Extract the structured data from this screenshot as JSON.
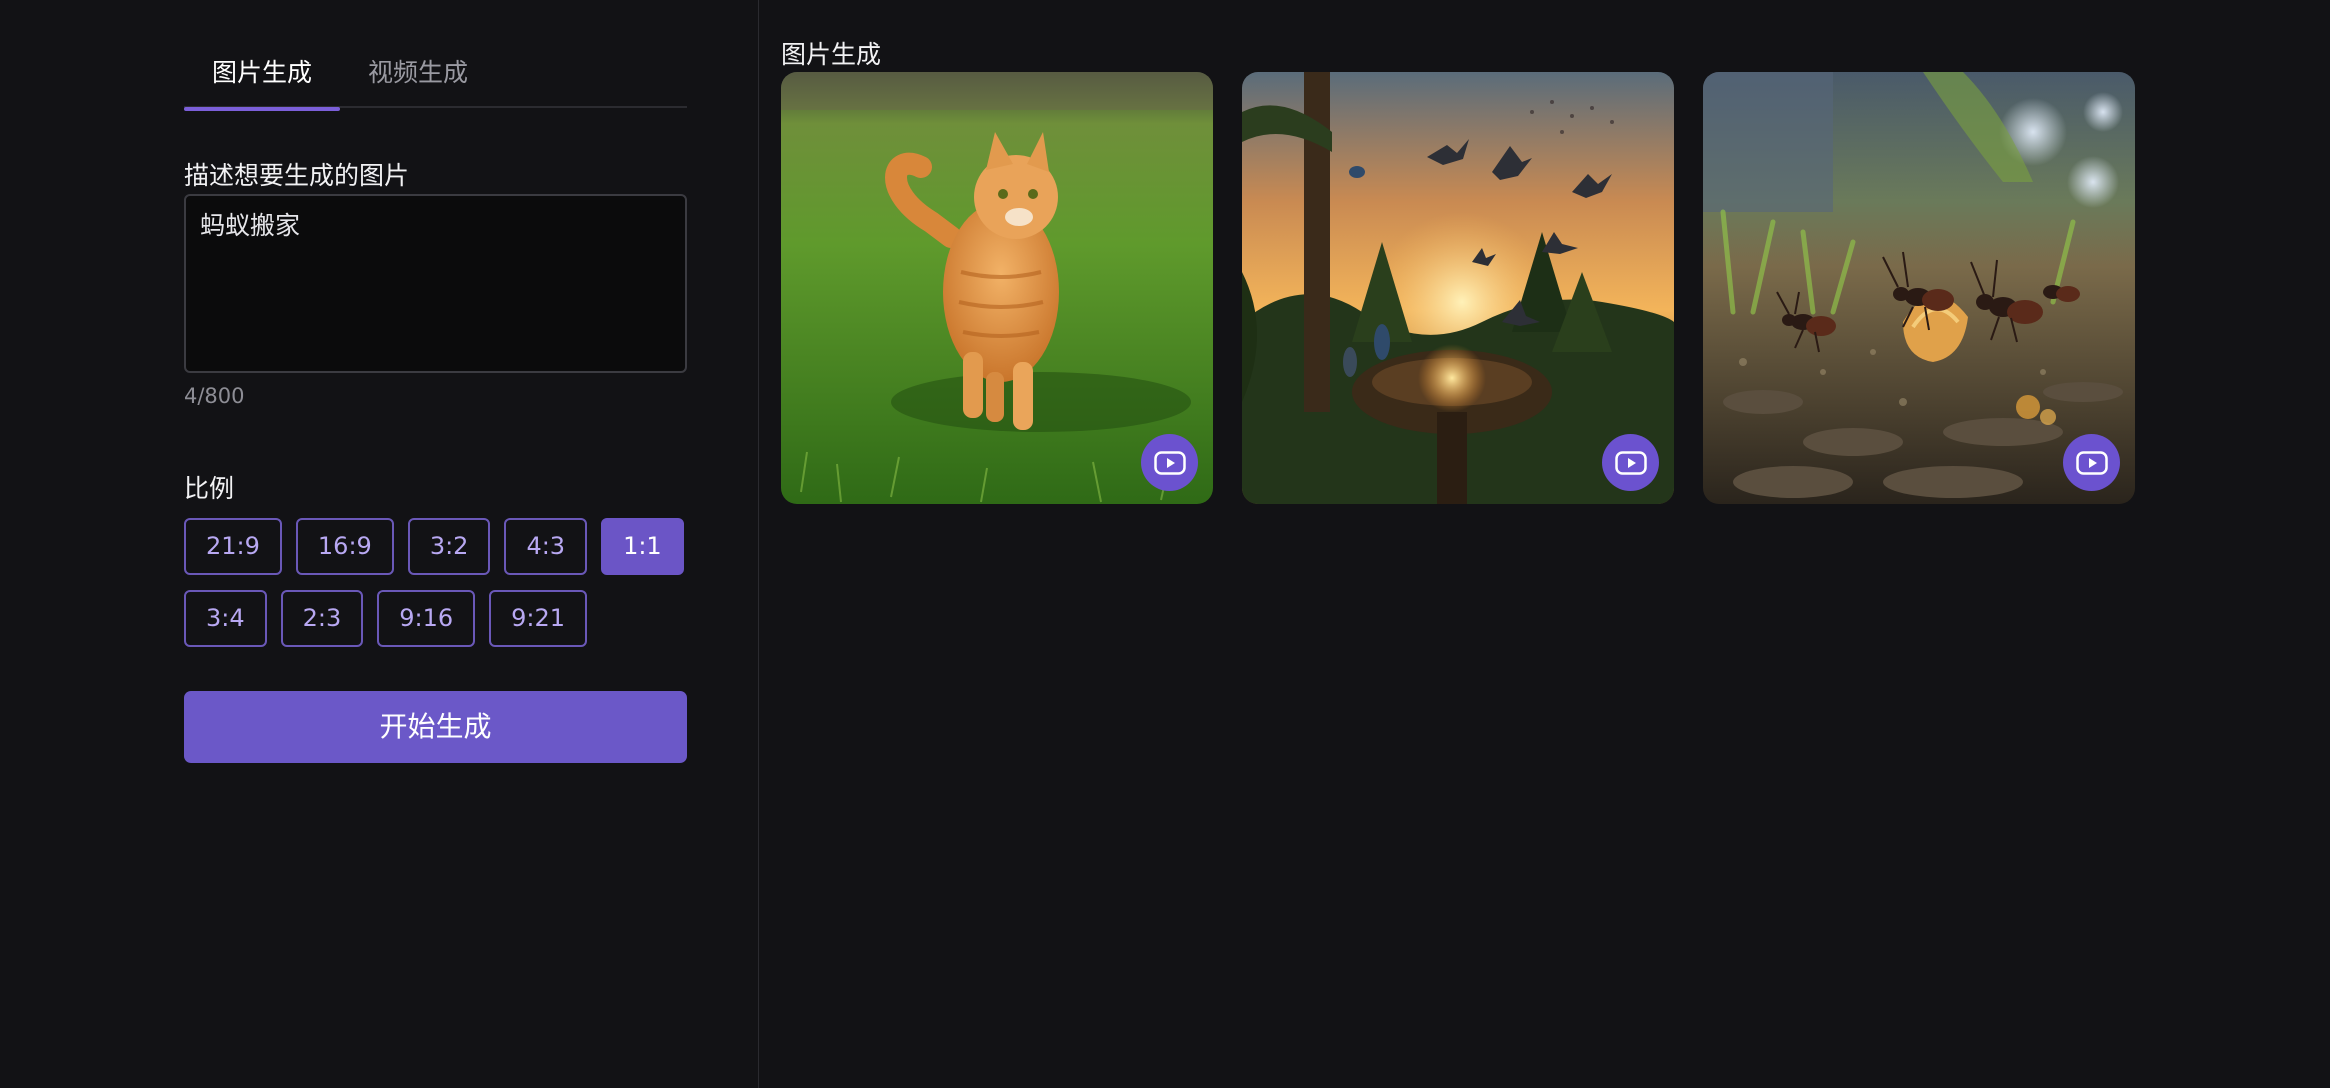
{
  "tabs": [
    {
      "label": "图片生成",
      "active": true
    },
    {
      "label": "视频生成",
      "active": false
    }
  ],
  "prompt": {
    "label": "描述想要生成的图片",
    "value": "蚂蚁搬家",
    "char_count": "4/800"
  },
  "ratio": {
    "label": "比例",
    "options_row1": [
      "21:9",
      "16:9",
      "3:2",
      "4:3",
      "1:1"
    ],
    "options_row2": [
      "3:4",
      "2:3",
      "9:16",
      "9:21"
    ],
    "selected": "1:1"
  },
  "generate_button": "开始生成",
  "gallery": {
    "title": "图片生成",
    "items": [
      {
        "subject": "orange cat walking on grass",
        "icon": "play-video-icon"
      },
      {
        "subject": "birds flying over a glowing nest at sunset",
        "icon": "play-video-icon"
      },
      {
        "subject": "ants carrying food on soil",
        "icon": "play-video-icon"
      }
    ]
  },
  "colors": {
    "background": "#121215",
    "accent": "#6b55c6",
    "accent_border": "#6a58b8"
  }
}
